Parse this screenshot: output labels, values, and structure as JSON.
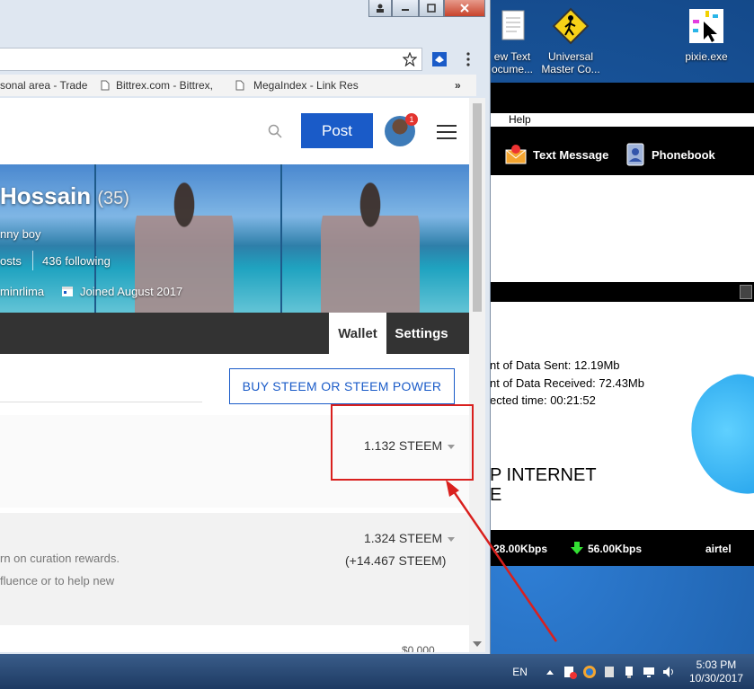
{
  "desktop": {
    "icons": [
      {
        "label1": "ew Text",
        "label2": "ocume..."
      },
      {
        "label1": "Universal",
        "label2": "Master Co..."
      },
      {
        "label1": "pixie.exe",
        "label2": ""
      }
    ]
  },
  "modem": {
    "menu_help": "Help",
    "text_message": "Text Message",
    "phonebook": "Phonebook",
    "data_sent": "nt of Data Sent: 12.19Mb",
    "data_received": "nt of Data Received: 72.43Mb",
    "connected_time": "ected time: 00:21:52",
    "brand_line1": "P INTERNET",
    "brand_line2": "E",
    "upload_speed": "28.00Kbps",
    "download_speed": "56.00Kbps",
    "carrier": "airtel"
  },
  "browser": {
    "bookmarks": [
      {
        "label": "sonal area - Trade"
      },
      {
        "label": "Bittrex.com - Bittrex,"
      },
      {
        "label": "MegaIndex - Link Res"
      }
    ],
    "more_bookmarks": "»"
  },
  "steemit": {
    "post_label": "Post",
    "notification_count": "1",
    "profile_name": "Hossain",
    "reputation": "(35)",
    "about": "nny boy",
    "posts_fragment": "osts",
    "following": "436 following",
    "location": "minrlima",
    "joined": "Joined August 2017",
    "tab_wallet": "Wallet",
    "tab_settings": "Settings",
    "buy_button": "BUY STEEM OR STEEM POWER",
    "steem_balance": "1.132 STEEM",
    "steem_power": "1.324 STEEM",
    "delegated": "(+14.467 STEEM)",
    "curation_text": "rn on curation rewards.",
    "influence_text": "fluence or to help new",
    "next_amount": "$0.000"
  },
  "taskbar": {
    "language": "EN",
    "time": "5:03 PM",
    "date": "10/30/2017"
  },
  "colors": {
    "accent": "#1a5bc8",
    "highlight_box": "#d9201e",
    "tab_bar": "#333333"
  }
}
